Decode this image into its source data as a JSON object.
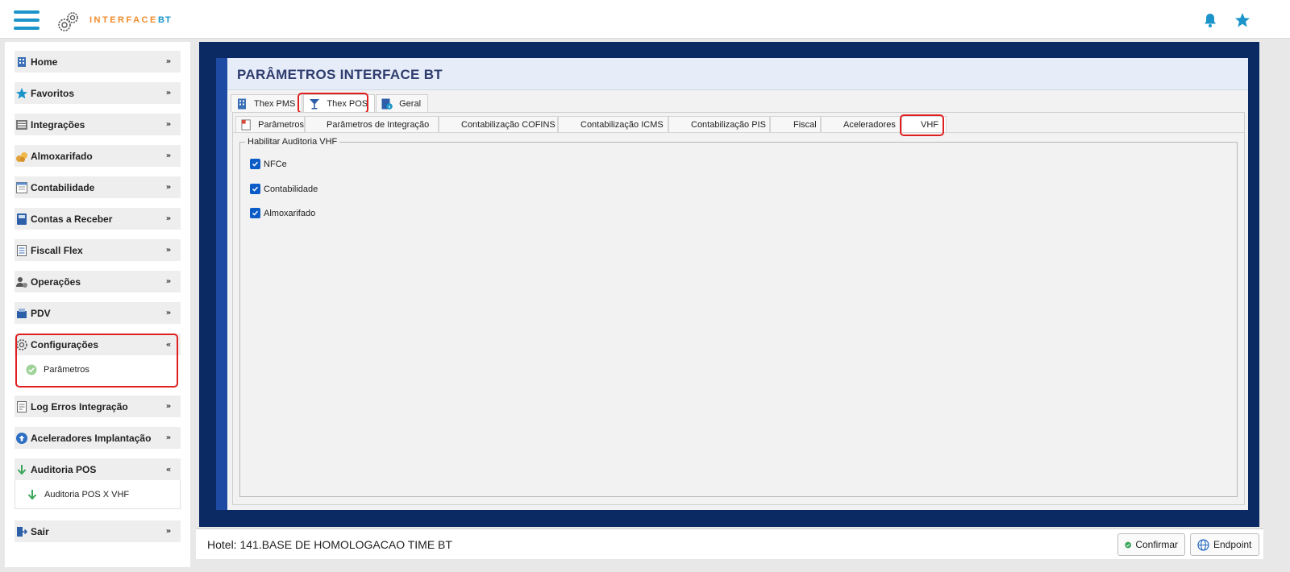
{
  "app": {
    "logo_text": "INTERFACE",
    "logo_suffix": "BT"
  },
  "topbar": {
    "icons": [
      "bell-icon",
      "star-icon"
    ],
    "accent_color": "#1a94c9"
  },
  "sidebar": {
    "items": [
      {
        "label": "Home",
        "icon": "building-icon",
        "expanded": false
      },
      {
        "label": "Favoritos",
        "icon": "star-icon",
        "expanded": false
      },
      {
        "label": "Integrações",
        "icon": "list-icon",
        "expanded": false
      },
      {
        "label": "Almoxarifado",
        "icon": "coins-icon",
        "expanded": false
      },
      {
        "label": "Contabilidade",
        "icon": "ledger-icon",
        "expanded": false
      },
      {
        "label": "Contas a Receber",
        "icon": "register-icon",
        "expanded": false
      },
      {
        "label": "Fiscall Flex",
        "icon": "document-icon",
        "expanded": false
      },
      {
        "label": "Operações",
        "icon": "user-gear-icon",
        "expanded": false
      },
      {
        "label": "PDV",
        "icon": "pos-icon",
        "expanded": false
      },
      {
        "label": "Configurações",
        "icon": "gear-icon",
        "expanded": true,
        "sub": [
          {
            "label": "Parâmetros",
            "icon": "check-circle-icon"
          }
        ]
      },
      {
        "label": "Log Erros Integração",
        "icon": "log-icon",
        "expanded": false
      },
      {
        "label": "Aceleradores Implantação",
        "icon": "upload-icon",
        "expanded": false
      },
      {
        "label": "Auditoria POS",
        "icon": "arrow-down-icon",
        "expanded": true,
        "sub": [
          {
            "label": "Auditoria POS X VHF",
            "icon": "arrow-down-icon"
          }
        ]
      },
      {
        "label": "Sair",
        "icon": "exit-icon",
        "expanded": false
      }
    ]
  },
  "panel": {
    "title": "PARÂMETROS INTERFACE BT",
    "tabs": [
      {
        "label": "Thex PMS",
        "icon": "building-icon",
        "active": false
      },
      {
        "label": "Thex POS",
        "icon": "cocktail-icon",
        "active": true
      },
      {
        "label": "Geral",
        "icon": "info-doc-icon",
        "active": false
      }
    ],
    "subtabs": [
      {
        "label": "Parâmetros",
        "icon": "doc-icon",
        "active": false
      },
      {
        "label": "Parâmetros de Integração",
        "active": false
      },
      {
        "label": "Contabilização COFINS",
        "active": false
      },
      {
        "label": "Contabilização ICMS",
        "active": false
      },
      {
        "label": "Contabilização PIS",
        "active": false
      },
      {
        "label": "Fiscal",
        "active": false
      },
      {
        "label": "Aceleradores",
        "active": false
      },
      {
        "label": "VHF",
        "active": true
      }
    ],
    "group": {
      "title": "Habilitar Auditoria VHF",
      "checkboxes": [
        {
          "label": "NFCe",
          "checked": true
        },
        {
          "label": "Contabilidade",
          "checked": true
        },
        {
          "label": "Almoxarifado",
          "checked": true
        }
      ]
    }
  },
  "footer": {
    "hotel": "Hotel: 141.BASE DE HOMOLOGACAO TIME BT",
    "confirm_label": "Confirmar",
    "endpoint_label": "Endpoint"
  },
  "colors": {
    "frame": "#0b2a63",
    "highlight": "#e02020",
    "checkbox": "#0c5cc8"
  }
}
